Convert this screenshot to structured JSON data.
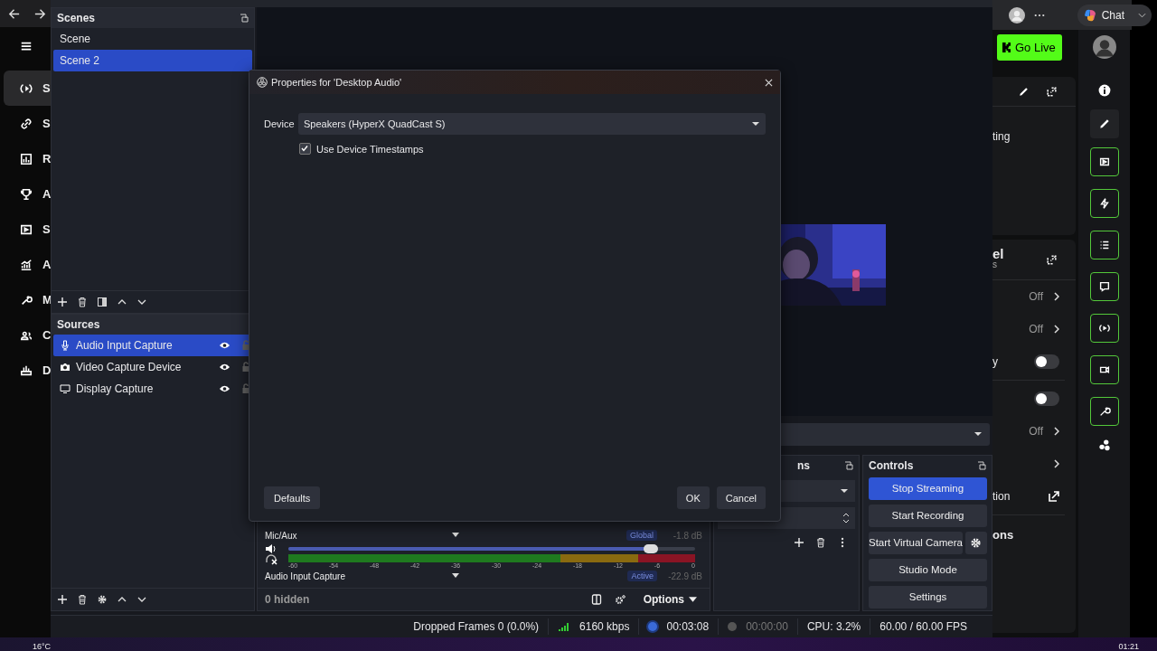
{
  "app_sidebar": {
    "items": [
      {
        "letter": "S",
        "selected": true
      },
      {
        "letter": "S",
        "selected": false
      },
      {
        "letter": "R",
        "selected": false
      },
      {
        "letter": "A",
        "selected": false
      },
      {
        "letter": "S",
        "selected": false
      },
      {
        "letter": "A",
        "selected": false
      },
      {
        "letter": "M",
        "selected": false
      },
      {
        "letter": "C",
        "selected": false
      },
      {
        "letter": "D",
        "selected": false
      }
    ]
  },
  "scenes": {
    "title": "Scenes",
    "items": [
      {
        "name": "Scene",
        "selected": false
      },
      {
        "name": "Scene 2",
        "selected": true
      }
    ]
  },
  "sources": {
    "title": "Sources",
    "items": [
      {
        "name": "Audio Input Capture",
        "kind": "audio",
        "selected": true,
        "visible": true,
        "locked": false
      },
      {
        "name": "Video Capture Device",
        "kind": "camera",
        "selected": false,
        "visible": true,
        "locked": false
      },
      {
        "name": "Display Capture",
        "kind": "display",
        "selected": false,
        "visible": true,
        "locked": false
      }
    ]
  },
  "mixer": {
    "channels": [
      {
        "name": "Mic/Aux",
        "badge": "Global",
        "reading": "-1.8 dB",
        "level": 0.89
      },
      {
        "name": "Audio Input Capture",
        "badge": "Active",
        "reading": "-22.9 dB"
      }
    ],
    "scale": [
      "-60",
      "-54",
      "-48",
      "-42",
      "-36",
      "-30",
      "-24",
      "-18",
      "-12",
      "-6",
      "0"
    ],
    "hidden_count": "0 hidden",
    "options": "Options"
  },
  "transitions": {
    "title": "ns"
  },
  "controls": {
    "title": "Controls",
    "buttons": [
      {
        "label": "Stop Streaming",
        "active": true,
        "settings": false
      },
      {
        "label": "Start Recording",
        "active": false,
        "settings": false
      },
      {
        "label": "Start Virtual Camera",
        "active": false,
        "settings": true
      },
      {
        "label": "Studio Mode",
        "active": false,
        "settings": false
      },
      {
        "label": "Settings",
        "active": false,
        "settings": false
      }
    ]
  },
  "status_bar": {
    "dropped": "Dropped Frames 0 (0.0%)",
    "bitrate": "6160 kbps",
    "stream_time": "00:03:08",
    "streaming": true,
    "record_time": "00:00:00",
    "recording": false,
    "cpu": "CPU: 3.2%",
    "fps": "60.00 / 60.00 FPS"
  },
  "dialog": {
    "title": "Properties for 'Desktop Audio'",
    "device_label": "Device",
    "device": "Speakers (HyperX QuadCast S)",
    "checkbox": {
      "label": "Use Device Timestamps",
      "checked": true
    },
    "buttons": [
      {
        "label": "Defaults",
        "kind": "left"
      },
      {
        "label": "OK",
        "kind": "right"
      },
      {
        "label": "Cancel",
        "kind": "right"
      }
    ]
  },
  "browser": {
    "chat": "Chat",
    "go_live": "Go Live"
  },
  "right_panel": {
    "card_text": "ting",
    "heading": [
      "el",
      "s"
    ],
    "rows": [
      {
        "kind": "select",
        "value": "Off"
      },
      {
        "kind": "select",
        "value": "Off"
      },
      {
        "kind": "toggle",
        "label": "y",
        "on": false
      },
      {
        "kind": "divider"
      },
      {
        "kind": "toggle",
        "on": false
      },
      {
        "kind": "select",
        "value": "Off"
      },
      {
        "kind": "select"
      },
      {
        "kind": "external",
        "label": "tion"
      }
    ],
    "footer_heading": "ons"
  },
  "taskbar": {
    "weather": "16°C",
    "clock": "01:21"
  }
}
